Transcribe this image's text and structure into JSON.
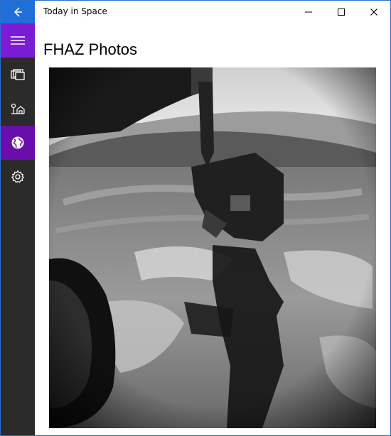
{
  "window": {
    "title": "Today in Space"
  },
  "titlebar": {
    "back_icon": "arrow-left-icon",
    "minimize_icon": "minimize-icon",
    "maximize_icon": "maximize-icon",
    "close_icon": "close-icon"
  },
  "nav": {
    "items": [
      {
        "icon": "hamburger-icon"
      },
      {
        "icon": "gallery-icon"
      },
      {
        "icon": "rover-icon"
      },
      {
        "icon": "globe-icon"
      },
      {
        "icon": "gear-icon"
      }
    ],
    "active_index": 3
  },
  "main": {
    "title": "FHAZ Photos"
  },
  "colors": {
    "accent": "#6a0dad",
    "titlebar_back": "#1f6fd8",
    "sidebar": "#2b2b2b"
  }
}
